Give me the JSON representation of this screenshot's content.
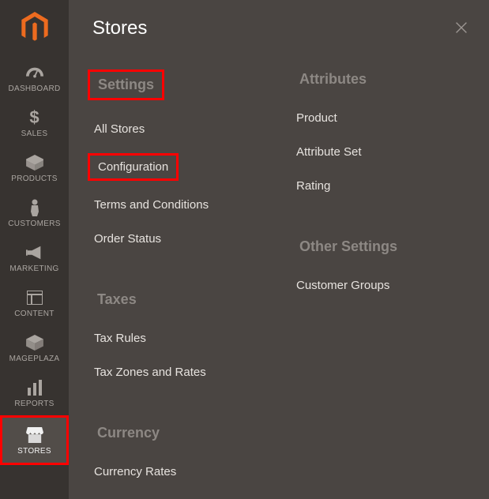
{
  "sidebar": {
    "items": [
      {
        "id": "dashboard",
        "label": "DASHBOARD",
        "icon": "gauge"
      },
      {
        "id": "sales",
        "label": "SALES",
        "icon": "dollar"
      },
      {
        "id": "products",
        "label": "PRODUCTS",
        "icon": "box"
      },
      {
        "id": "customers",
        "label": "CUSTOMERS",
        "icon": "person"
      },
      {
        "id": "marketing",
        "label": "MARKETING",
        "icon": "megaphone"
      },
      {
        "id": "content",
        "label": "CONTENT",
        "icon": "layout"
      },
      {
        "id": "mageplaza",
        "label": "MAGEPLAZA",
        "icon": "package"
      },
      {
        "id": "reports",
        "label": "REPORTS",
        "icon": "bars"
      },
      {
        "id": "stores",
        "label": "STORES",
        "icon": "storefront"
      }
    ]
  },
  "panel": {
    "title": "Stores",
    "left": [
      {
        "type": "header",
        "text": "Settings",
        "highlight": true
      },
      {
        "type": "link",
        "text": "All Stores"
      },
      {
        "type": "link",
        "text": "Configuration",
        "highlight": true
      },
      {
        "type": "link",
        "text": "Terms and Conditions"
      },
      {
        "type": "link",
        "text": "Order Status"
      },
      {
        "type": "spacer"
      },
      {
        "type": "header",
        "text": "Taxes"
      },
      {
        "type": "link",
        "text": "Tax Rules"
      },
      {
        "type": "link",
        "text": "Tax Zones and Rates"
      },
      {
        "type": "spacer"
      },
      {
        "type": "header",
        "text": "Currency"
      },
      {
        "type": "link",
        "text": "Currency Rates"
      }
    ],
    "right": [
      {
        "type": "header",
        "text": "Attributes"
      },
      {
        "type": "link",
        "text": "Product"
      },
      {
        "type": "link",
        "text": "Attribute Set"
      },
      {
        "type": "link",
        "text": "Rating"
      },
      {
        "type": "spacer"
      },
      {
        "type": "header",
        "text": "Other Settings"
      },
      {
        "type": "link",
        "text": "Customer Groups"
      }
    ]
  }
}
